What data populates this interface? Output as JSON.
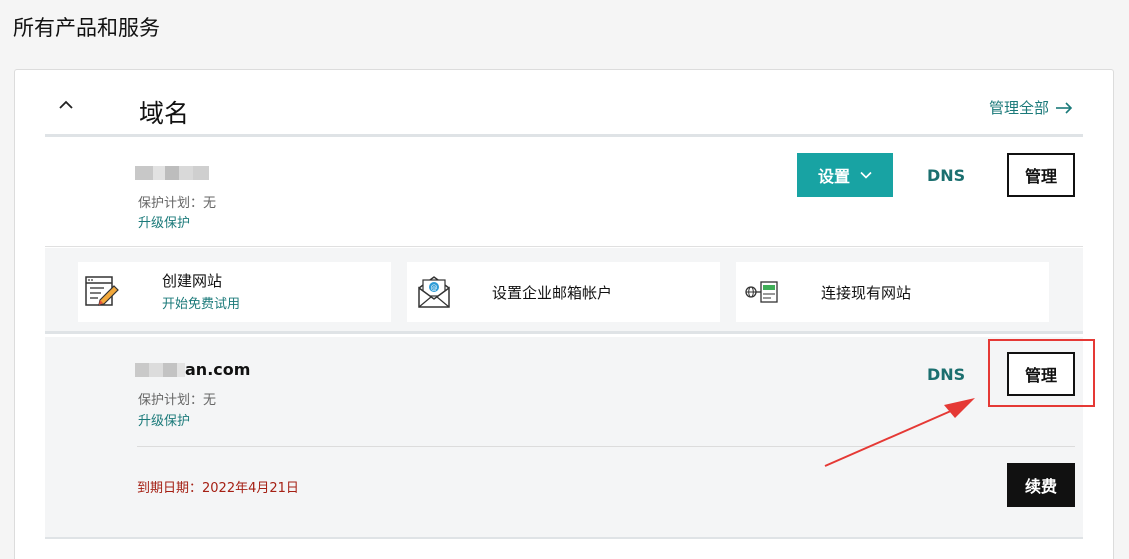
{
  "page": {
    "title": "所有产品和服务"
  },
  "section": {
    "title": "域名",
    "manage_all_label": "管理全部"
  },
  "domains": [
    {
      "name_suffix": "",
      "plan": "保护计划：无",
      "upgrade": "升级保护",
      "settings_label": "设置",
      "dns_label": "DNS",
      "manage_label": "管理"
    },
    {
      "name_suffix": "an.com",
      "plan": "保护计划：无",
      "upgrade": "升级保护",
      "dns_label": "DNS",
      "manage_label": "管理",
      "expiry": "到期日期：2022年4月21日",
      "renew_label": "续费"
    }
  ],
  "services": [
    {
      "title": "创建网站",
      "subtitle": "开始免费试用",
      "icon": "website-builder-icon"
    },
    {
      "title": "设置企业邮箱帐户",
      "subtitle": "",
      "icon": "email-envelope-icon"
    },
    {
      "title": "连接现有网站",
      "subtitle": "",
      "icon": "connect-site-icon"
    }
  ],
  "colors": {
    "accent": "#18a3a3",
    "link": "#1b7a7a",
    "expiry": "#a52014",
    "annotation": "#e53935"
  }
}
